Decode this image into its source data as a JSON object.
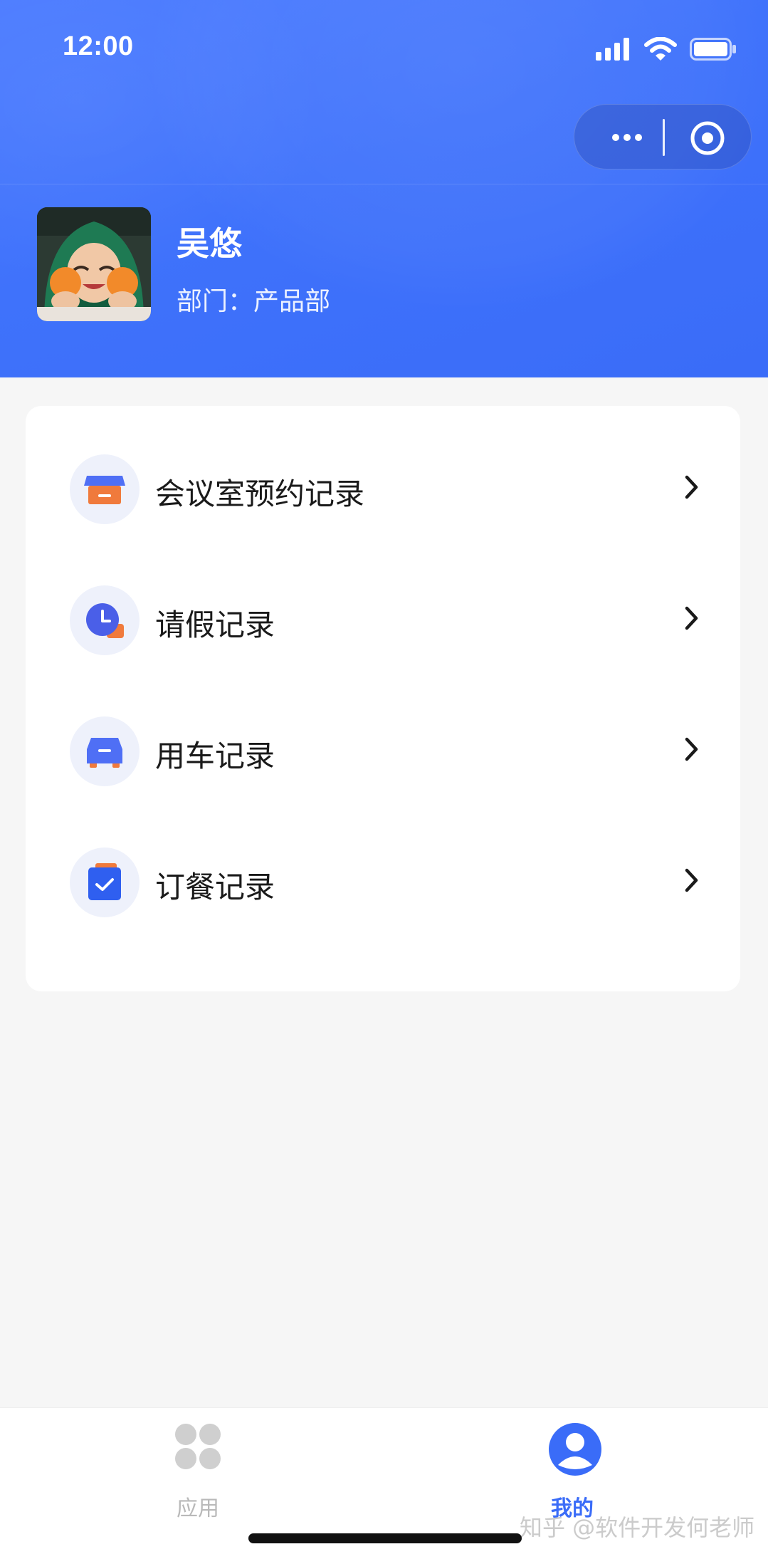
{
  "status_bar": {
    "time": "12:00",
    "icons": [
      "signal-icon",
      "wifi-icon",
      "battery-icon"
    ]
  },
  "capsule": {
    "more_icon": "more-dots-icon",
    "close_icon": "target-circle-icon"
  },
  "profile": {
    "name": "吴悠",
    "department": "部门：产品部"
  },
  "menu": {
    "items": [
      {
        "label": "会议室预约记录",
        "icon": "meeting-room-icon"
      },
      {
        "label": "请假记录",
        "icon": "clock-leave-icon"
      },
      {
        "label": "用车记录",
        "icon": "car-icon"
      },
      {
        "label": "订餐记录",
        "icon": "clipboard-check-icon"
      }
    ]
  },
  "tabbar": {
    "tabs": [
      {
        "label": "应用",
        "icon": "apps-grid-icon",
        "active": false
      },
      {
        "label": "我的",
        "icon": "user-profile-icon",
        "active": true
      }
    ]
  },
  "watermark": "知乎 @软件开发何老师",
  "colors": {
    "brand": "#3a6cf8",
    "orange": "#f07a3c",
    "inactive": "#b9b9b9"
  }
}
